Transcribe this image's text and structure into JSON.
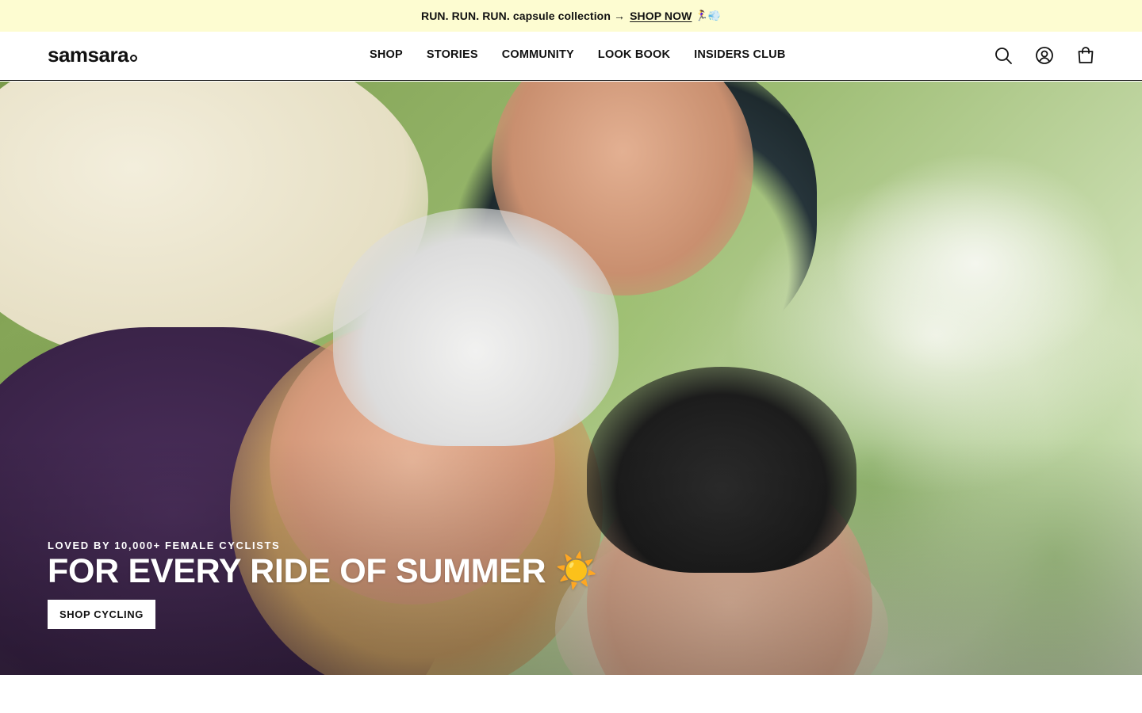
{
  "announcement": {
    "text": "RUN. RUN. RUN. capsule collection",
    "arrow": "→",
    "link_label": "SHOP NOW",
    "emoji": "🏃‍♀️💨",
    "background": "#fdfcd1"
  },
  "header": {
    "logo": "samsara",
    "nav": [
      {
        "label": "SHOP"
      },
      {
        "label": "STORIES"
      },
      {
        "label": "COMMUNITY"
      },
      {
        "label": "LOOK BOOK"
      },
      {
        "label": "INSIDERS CLUB"
      }
    ],
    "icons": [
      "search-icon",
      "account-icon",
      "shopping-bag-icon"
    ]
  },
  "hero": {
    "eyebrow": "LOVED BY 10,000+ FEMALE CYCLISTS",
    "headline": "FOR EVERY RIDE OF SUMMER ☀️",
    "cta_label": "SHOP CYCLING"
  }
}
